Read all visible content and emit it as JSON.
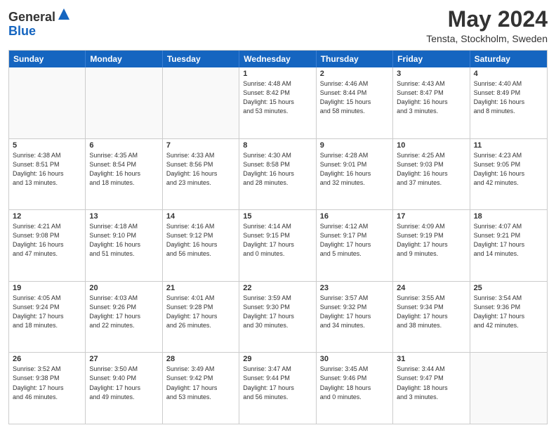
{
  "logo": {
    "general": "General",
    "blue": "Blue"
  },
  "title": "May 2024",
  "subtitle": "Tensta, Stockholm, Sweden",
  "headers": [
    "Sunday",
    "Monday",
    "Tuesday",
    "Wednesday",
    "Thursday",
    "Friday",
    "Saturday"
  ],
  "weeks": [
    [
      {
        "day": "",
        "text": ""
      },
      {
        "day": "",
        "text": ""
      },
      {
        "day": "",
        "text": ""
      },
      {
        "day": "1",
        "text": "Sunrise: 4:48 AM\nSunset: 8:42 PM\nDaylight: 15 hours\nand 53 minutes."
      },
      {
        "day": "2",
        "text": "Sunrise: 4:46 AM\nSunset: 8:44 PM\nDaylight: 15 hours\nand 58 minutes."
      },
      {
        "day": "3",
        "text": "Sunrise: 4:43 AM\nSunset: 8:47 PM\nDaylight: 16 hours\nand 3 minutes."
      },
      {
        "day": "4",
        "text": "Sunrise: 4:40 AM\nSunset: 8:49 PM\nDaylight: 16 hours\nand 8 minutes."
      }
    ],
    [
      {
        "day": "5",
        "text": "Sunrise: 4:38 AM\nSunset: 8:51 PM\nDaylight: 16 hours\nand 13 minutes."
      },
      {
        "day": "6",
        "text": "Sunrise: 4:35 AM\nSunset: 8:54 PM\nDaylight: 16 hours\nand 18 minutes."
      },
      {
        "day": "7",
        "text": "Sunrise: 4:33 AM\nSunset: 8:56 PM\nDaylight: 16 hours\nand 23 minutes."
      },
      {
        "day": "8",
        "text": "Sunrise: 4:30 AM\nSunset: 8:58 PM\nDaylight: 16 hours\nand 28 minutes."
      },
      {
        "day": "9",
        "text": "Sunrise: 4:28 AM\nSunset: 9:01 PM\nDaylight: 16 hours\nand 32 minutes."
      },
      {
        "day": "10",
        "text": "Sunrise: 4:25 AM\nSunset: 9:03 PM\nDaylight: 16 hours\nand 37 minutes."
      },
      {
        "day": "11",
        "text": "Sunrise: 4:23 AM\nSunset: 9:05 PM\nDaylight: 16 hours\nand 42 minutes."
      }
    ],
    [
      {
        "day": "12",
        "text": "Sunrise: 4:21 AM\nSunset: 9:08 PM\nDaylight: 16 hours\nand 47 minutes."
      },
      {
        "day": "13",
        "text": "Sunrise: 4:18 AM\nSunset: 9:10 PM\nDaylight: 16 hours\nand 51 minutes."
      },
      {
        "day": "14",
        "text": "Sunrise: 4:16 AM\nSunset: 9:12 PM\nDaylight: 16 hours\nand 56 minutes."
      },
      {
        "day": "15",
        "text": "Sunrise: 4:14 AM\nSunset: 9:15 PM\nDaylight: 17 hours\nand 0 minutes."
      },
      {
        "day": "16",
        "text": "Sunrise: 4:12 AM\nSunset: 9:17 PM\nDaylight: 17 hours\nand 5 minutes."
      },
      {
        "day": "17",
        "text": "Sunrise: 4:09 AM\nSunset: 9:19 PM\nDaylight: 17 hours\nand 9 minutes."
      },
      {
        "day": "18",
        "text": "Sunrise: 4:07 AM\nSunset: 9:21 PM\nDaylight: 17 hours\nand 14 minutes."
      }
    ],
    [
      {
        "day": "19",
        "text": "Sunrise: 4:05 AM\nSunset: 9:24 PM\nDaylight: 17 hours\nand 18 minutes."
      },
      {
        "day": "20",
        "text": "Sunrise: 4:03 AM\nSunset: 9:26 PM\nDaylight: 17 hours\nand 22 minutes."
      },
      {
        "day": "21",
        "text": "Sunrise: 4:01 AM\nSunset: 9:28 PM\nDaylight: 17 hours\nand 26 minutes."
      },
      {
        "day": "22",
        "text": "Sunrise: 3:59 AM\nSunset: 9:30 PM\nDaylight: 17 hours\nand 30 minutes."
      },
      {
        "day": "23",
        "text": "Sunrise: 3:57 AM\nSunset: 9:32 PM\nDaylight: 17 hours\nand 34 minutes."
      },
      {
        "day": "24",
        "text": "Sunrise: 3:55 AM\nSunset: 9:34 PM\nDaylight: 17 hours\nand 38 minutes."
      },
      {
        "day": "25",
        "text": "Sunrise: 3:54 AM\nSunset: 9:36 PM\nDaylight: 17 hours\nand 42 minutes."
      }
    ],
    [
      {
        "day": "26",
        "text": "Sunrise: 3:52 AM\nSunset: 9:38 PM\nDaylight: 17 hours\nand 46 minutes."
      },
      {
        "day": "27",
        "text": "Sunrise: 3:50 AM\nSunset: 9:40 PM\nDaylight: 17 hours\nand 49 minutes."
      },
      {
        "day": "28",
        "text": "Sunrise: 3:49 AM\nSunset: 9:42 PM\nDaylight: 17 hours\nand 53 minutes."
      },
      {
        "day": "29",
        "text": "Sunrise: 3:47 AM\nSunset: 9:44 PM\nDaylight: 17 hours\nand 56 minutes."
      },
      {
        "day": "30",
        "text": "Sunrise: 3:45 AM\nSunset: 9:46 PM\nDaylight: 18 hours\nand 0 minutes."
      },
      {
        "day": "31",
        "text": "Sunrise: 3:44 AM\nSunset: 9:47 PM\nDaylight: 18 hours\nand 3 minutes."
      },
      {
        "day": "",
        "text": ""
      }
    ]
  ]
}
